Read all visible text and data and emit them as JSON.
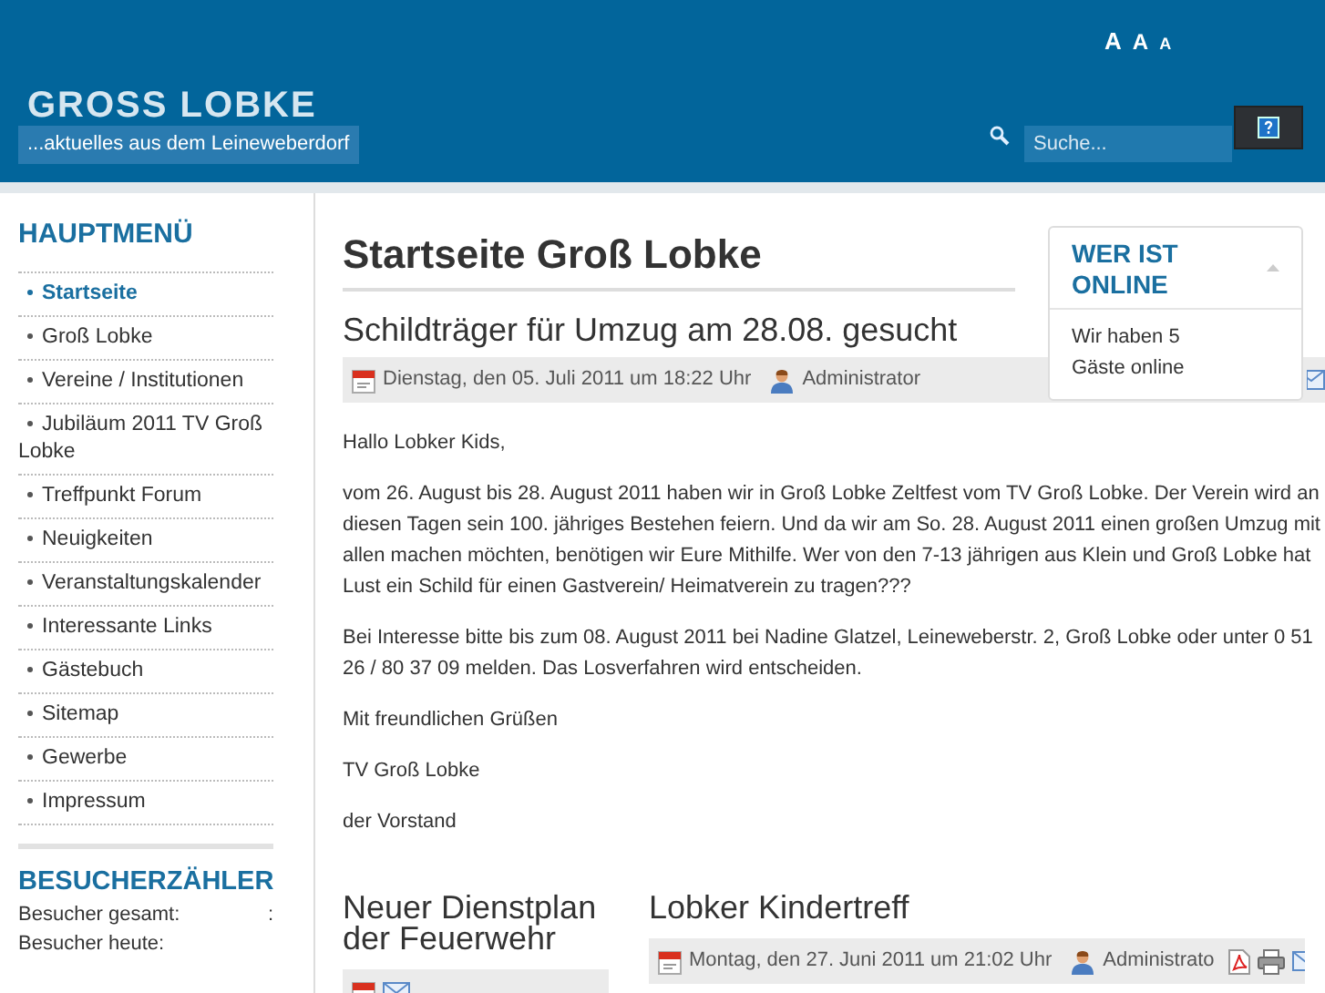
{
  "header": {
    "site_title": "GROSS LOBKE",
    "tagline": "...aktuelles aus dem Leineweberdorf",
    "font_size_controls": [
      {
        "kind": "larger",
        "label": "A"
      },
      {
        "kind": "reset",
        "label": "A"
      },
      {
        "kind": "smaller",
        "label": "A"
      }
    ],
    "search": {
      "placeholder": "Suche..."
    }
  },
  "sidebar": {
    "menu_title": "HAUPTMENÜ",
    "items": [
      {
        "label": "Startseite",
        "selected": true
      },
      {
        "label": "Groß Lobke",
        "selected": false
      },
      {
        "label": "Vereine / Institutionen",
        "selected": false
      },
      {
        "label": "Jubiläum 2011 TV Groß Lobke",
        "selected": false
      },
      {
        "label": "Treffpunkt Forum",
        "selected": false
      },
      {
        "label": "Neuigkeiten",
        "selected": false
      },
      {
        "label": "Veranstaltungskalender",
        "selected": false
      },
      {
        "label": "Interessante Links",
        "selected": false
      },
      {
        "label": "Gästebuch",
        "selected": false
      },
      {
        "label": "Sitemap",
        "selected": false
      },
      {
        "label": "Gewerbe",
        "selected": false
      },
      {
        "label": "Impressum",
        "selected": false
      }
    ],
    "counter_title": "BESUCHERZÄHLER",
    "counter_rows": [
      {
        "label": "Besucher gesamt:",
        "value": ":"
      },
      {
        "label": "Besucher heute:"
      }
    ]
  },
  "page_title": "Startseite Groß Lobke",
  "article": {
    "title": "Schildträger für Umzug am 28.08. gesucht",
    "date": "Dienstag, den 05. Juli 2011 um 18:22 Uhr",
    "author": "Administrator",
    "paragraphs": [
      "Hallo Lobker Kids,",
      "vom 26. August bis 28. August 2011 haben wir in Groß Lobke Zeltfest vom TV Groß Lobke. Der Verein wird an diesen Tagen sein 100. jähriges Bestehen feiern. Und da wir am So. 28. August 2011 einen großen Umzug mit allen machen möchten, benötigen wir Eure Mithilfe. Wer von den 7-13 jährigen aus Klein und Groß Lobke hat Lust ein Schild für einen Gastverein/ Heimatverein zu tragen???",
      "Bei Interesse bitte bis zum 08. August 2011 bei Nadine Glatzel, Leineweberstr. 2, Groß Lobke oder unter 0 51 26 / 80 37 09 melden. Das Losverfahren wird entscheiden.",
      "Mit freundlichen Grüßen",
      "TV Groß Lobke",
      "der Vorstand"
    ]
  },
  "teasers": [
    {
      "title": "Neuer Dienstplan der Feuerwehr"
    },
    {
      "title": "Lobker Kindertreff",
      "date": "Montag, den 27. Juni 2011 um 21:02 Uhr",
      "author": "Administrato"
    }
  ],
  "who_online": {
    "title": "WER IST ONLINE",
    "text": "Wir haben 5 Gäste online",
    "expanded": true
  }
}
